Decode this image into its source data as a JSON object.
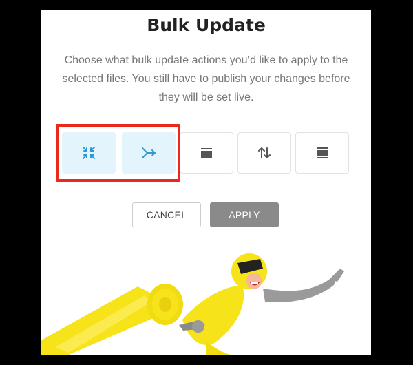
{
  "dialog": {
    "title": "Bulk Update",
    "description": "Choose what bulk update actions you’d like to apply to the selected files. You still have to publish your changes before they will be set live."
  },
  "actions": [
    {
      "icon": "compress-arrows-icon",
      "state": "selected"
    },
    {
      "icon": "merge-arrow-icon",
      "state": "selected"
    },
    {
      "icon": "layers-icon",
      "state": "default"
    },
    {
      "icon": "sort-arrows-icon",
      "state": "default"
    },
    {
      "icon": "stack-icon",
      "state": "default"
    }
  ],
  "buttons": {
    "cancel_label": "CANCEL",
    "apply_label": "APPLY"
  },
  "colors": {
    "accent_blue": "#2b9bd6",
    "selected_tile_bg": "#e3f4fc",
    "highlight_red": "#e8291c",
    "apply_bg": "#8a8a8a",
    "mascot_yellow": "#f7e319"
  }
}
